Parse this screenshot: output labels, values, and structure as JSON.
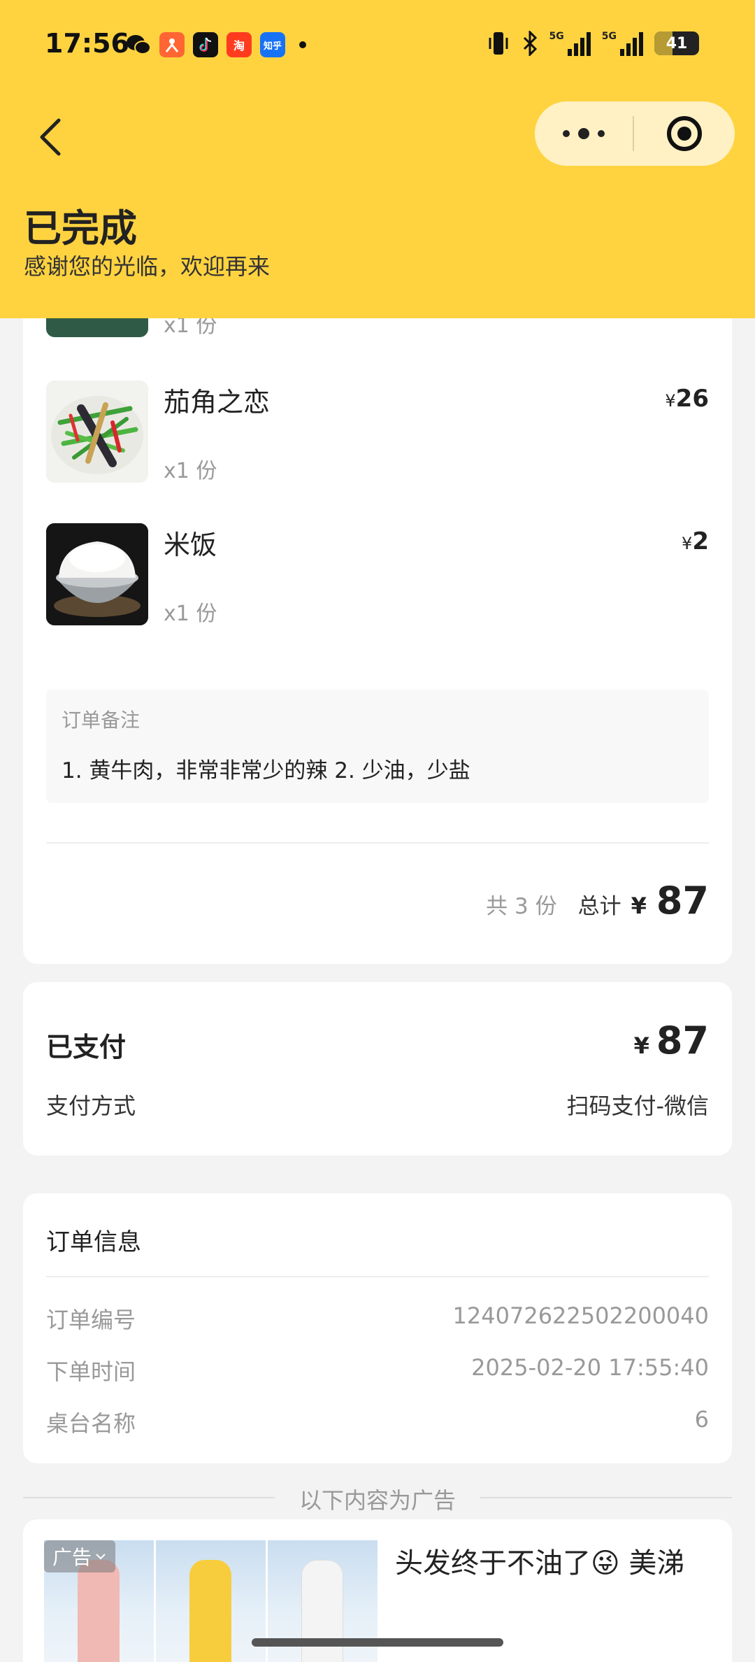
{
  "status_bar": {
    "time": "17:56",
    "apps": [
      {
        "name": "wechat-icon",
        "label": "",
        "color": "#111111"
      },
      {
        "name": "dianping-icon",
        "label": "",
        "color": "#ff6633"
      },
      {
        "name": "douyin-icon",
        "label": "",
        "color": "#111111"
      },
      {
        "name": "taobao-icon",
        "label": "淘",
        "color": "#ff3b1f"
      },
      {
        "name": "zhihu-icon",
        "label": "知乎",
        "color": "#1772f6"
      }
    ],
    "signal_label_1": "5G",
    "signal_label_2": "5G",
    "battery": "41"
  },
  "header": {
    "status_title": "已完成",
    "status_subtitle": "感谢您的光临，欢迎再来"
  },
  "order_items": [
    {
      "name": "",
      "qty": "x1 份",
      "price": ""
    },
    {
      "name": "茄角之恋",
      "qty": "x1 份",
      "price_symbol": "¥",
      "price": "26"
    },
    {
      "name": "米饭",
      "qty": "x1 份",
      "price_symbol": "¥",
      "price": "2"
    }
  ],
  "note": {
    "label": "订单备注",
    "text": "1. 黄牛肉，非常非常少的辣 2. 少油，少盐"
  },
  "summary": {
    "count": "共 3 份",
    "total_label": "总计",
    "yen": "¥",
    "total": "87"
  },
  "payment": {
    "title": "已支付",
    "yen": "¥",
    "amount": "87",
    "method_label": "支付方式",
    "method_value": "扫码支付-微信"
  },
  "order_info": {
    "title": "订单信息",
    "rows": [
      {
        "key": "订单编号",
        "value": "124072622502200040"
      },
      {
        "key": "下单时间",
        "value": "2025-02-20 17:55:40"
      },
      {
        "key": "桌台名称",
        "value": "6"
      }
    ]
  },
  "ad": {
    "divider_text": "以下内容为广告",
    "tag": "广告",
    "title": "头发终于不油了😜 美涕"
  },
  "colors": {
    "header_bg": "#ffd340",
    "capsule_bg": "#fff1c4"
  }
}
